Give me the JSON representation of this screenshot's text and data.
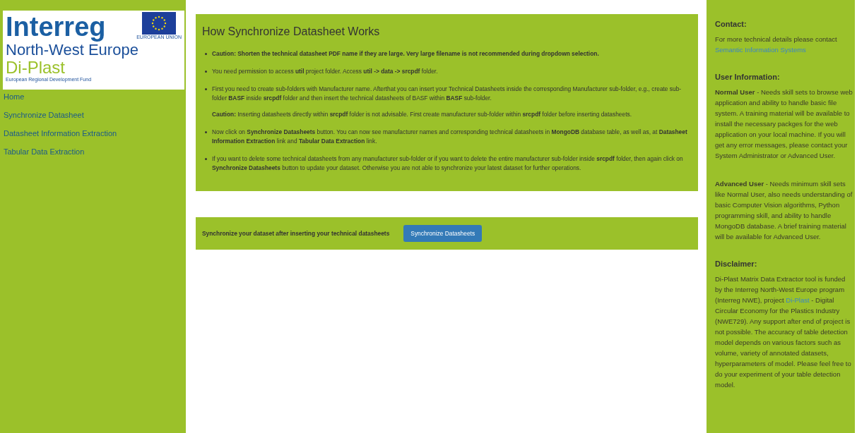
{
  "logo": {
    "title": "Interreg",
    "subtitle": "North-West Europe",
    "project": "Di-Plast",
    "fund": "European Regional Development Fund",
    "flag_caption": "EUROPEAN UNION"
  },
  "nav": [
    {
      "label": "Home"
    },
    {
      "label": "Synchronize Datasheet"
    },
    {
      "label": "Datasheet Information Extraction"
    },
    {
      "label": "Tabular Data Extraction"
    }
  ],
  "info_panel": {
    "title": "How Synchronize Datasheet Works",
    "items": [
      {
        "text": "**Caution: Shorten the technical datasheet PDF name if they are large. Very large filename is not recommended during dropdown selection.**"
      },
      {
        "text": "You need permission to access **util** project folder. Access **util -> data -> srcpdf** folder."
      },
      {
        "text": "First you need to create sub-folders with Manufacturer name. Afterthat you can insert your Technical Datasheets inside the corresponding Manufacturer sub-folder, e.g., create sub-folder **BASF** inside **srcpdf** folder and then insert the technical datasheets of BASF within **BASF** sub-folder.",
        "note": "**Caution:** Inserting datasheets directly within **srcpdf** folder is not advisable. First create manufacturer sub-folder within **srcpdf** folder before inserting datasheets."
      },
      {
        "text": "Now click on **Synchronize Datasheets** button. You can now see manufacturer names and corresponding technical datasheets in **MongoDB** database table, as well as, at **Datasheet Information Extraction** link and **Tabular Data Extraction** link."
      },
      {
        "text": "If you want to delete some technical datasheets from any manufacturer sub-folder or if you want to delete the entire manufacturer sub-folder inside **srcpdf** folder, then again click on **Synchronize Datasheets** button to update your dataset. Otherwise you are not able to synchronize your latest dataset for further operations."
      }
    ]
  },
  "sync_panel": {
    "label": "Synchronize your dataset after inserting your technical datasheets",
    "button": "Synchronize Datasheets"
  },
  "right_sidebar": [
    {
      "heading": "Contact:",
      "paragraphs": [
        [
          {
            "kind": "text",
            "text": "For more technical details please contact "
          },
          {
            "kind": "link",
            "text": "Semantic Information Systems"
          }
        ]
      ]
    },
    {
      "heading": "User Information:",
      "paragraphs": [
        [
          {
            "kind": "text",
            "text": "**Normal User** - Needs skill sets to browse web application and ability to handle basic file system. A training material will be available to install the necessary packges for the web application on your local machine. If you will get any error messages, please contact your System Administrator or Advanced User."
          }
        ],
        [
          {
            "kind": "text",
            "text": "**Advanced User** - Needs minimum skill sets like Normal User, also needs understanding of basic Computer Vision algorithms, Python programming skill, and ability to handle MongoDB database. A brief training material will be available for Advanced User."
          }
        ]
      ]
    },
    {
      "heading": "Disclaimer:",
      "paragraphs": [
        [
          {
            "kind": "text",
            "text": "Di-Plast Matrix Data Extractor tool is funded by the Interreg North-West Europe program (Interreg NWE), project "
          },
          {
            "kind": "link",
            "text": "Di-Plast"
          },
          {
            "kind": "text",
            "text": " - Digital Circular Economy for the Plastics Industry (NWE729). Any support after end of project is not possible. The accuracy of table detection model depends on various factors such as volume, variety of annotated datasets, hyperparameters of model. Please feel free to do your experiment of your table detection model."
          }
        ]
      ]
    }
  ]
}
